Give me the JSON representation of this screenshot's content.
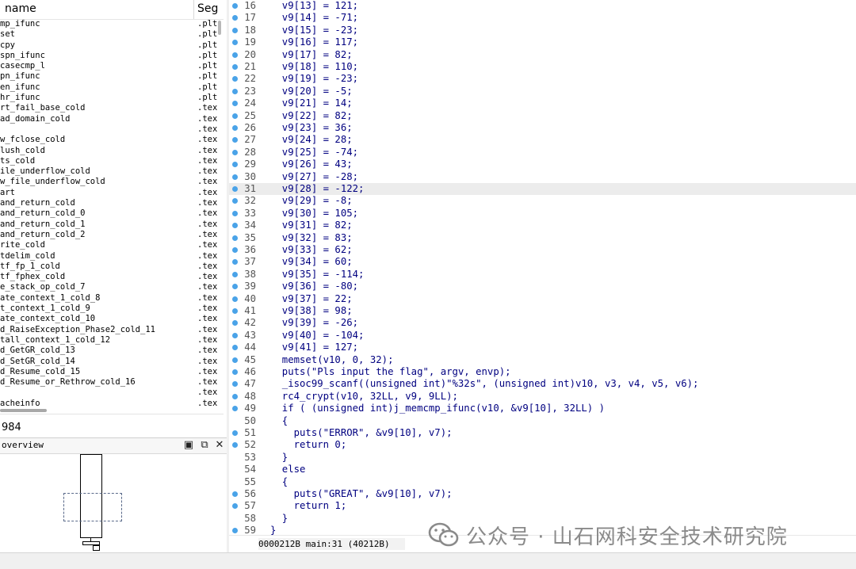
{
  "functions_panel": {
    "col_name": "name",
    "col_segment": "Seg",
    "rows": [
      {
        "name": "mp_ifunc",
        "seg": ".plt"
      },
      {
        "name": "set",
        "seg": ".plt"
      },
      {
        "name": "cpy",
        "seg": ".plt"
      },
      {
        "name": "spn_ifunc",
        "seg": ".plt"
      },
      {
        "name": "casecmp_l",
        "seg": ".plt"
      },
      {
        "name": "pn_ifunc",
        "seg": ".plt"
      },
      {
        "name": "en_ifunc",
        "seg": ".plt"
      },
      {
        "name": "hr_ifunc",
        "seg": ".plt"
      },
      {
        "name": "rt_fail_base_cold",
        "seg": ".tex"
      },
      {
        "name": "ad_domain_cold",
        "seg": ".tex"
      },
      {
        "name": "",
        "seg": ".tex"
      },
      {
        "name": "w_fclose_cold",
        "seg": ".tex"
      },
      {
        "name": "lush_cold",
        "seg": ".tex"
      },
      {
        "name": "ts_cold",
        "seg": ".tex"
      },
      {
        "name": "ile_underflow_cold",
        "seg": ".tex"
      },
      {
        "name": "w_file_underflow_cold",
        "seg": ".tex"
      },
      {
        "name": "art",
        "seg": ".tex"
      },
      {
        "name": "and_return_cold",
        "seg": ".tex"
      },
      {
        "name": "and_return_cold_0",
        "seg": ".tex"
      },
      {
        "name": "and_return_cold_1",
        "seg": ".tex"
      },
      {
        "name": "and_return_cold_2",
        "seg": ".tex"
      },
      {
        "name": "rite_cold",
        "seg": ".tex"
      },
      {
        "name": "tdelim_cold",
        "seg": ".tex"
      },
      {
        "name": "tf_fp_1_cold",
        "seg": ".tex"
      },
      {
        "name": "tf_fphex_cold",
        "seg": ".tex"
      },
      {
        "name": "e_stack_op_cold_7",
        "seg": ".tex"
      },
      {
        "name": "ate_context_1_cold_8",
        "seg": ".tex"
      },
      {
        "name": "t_context_1_cold_9",
        "seg": ".tex"
      },
      {
        "name": "ate_context_cold_10",
        "seg": ".tex"
      },
      {
        "name": "d_RaiseException_Phase2_cold_11",
        "seg": ".tex"
      },
      {
        "name": "tall_context_1_cold_12",
        "seg": ".tex"
      },
      {
        "name": "d_GetGR_cold_13",
        "seg": ".tex"
      },
      {
        "name": "d_SetGR_cold_14",
        "seg": ".tex"
      },
      {
        "name": "d_Resume_cold_15",
        "seg": ".tex"
      },
      {
        "name": "d_Resume_or_Rethrow_cold_16",
        "seg": ".tex"
      },
      {
        "name": "",
        "seg": ".tex"
      },
      {
        "name": "acheinfo",
        "seg": ".tex"
      }
    ],
    "line_count": "984"
  },
  "overview": {
    "title": "overview",
    "btn_float": "▣",
    "btn_restore": "⧉",
    "btn_close": "✕"
  },
  "code": {
    "lines": [
      {
        "n": "16",
        "dot": true,
        "t": "  v9[13] = 121;"
      },
      {
        "n": "17",
        "dot": true,
        "t": "  v9[14] = -71;"
      },
      {
        "n": "18",
        "dot": true,
        "t": "  v9[15] = -23;"
      },
      {
        "n": "19",
        "dot": true,
        "t": "  v9[16] = 117;"
      },
      {
        "n": "20",
        "dot": true,
        "t": "  v9[17] = 82;"
      },
      {
        "n": "21",
        "dot": true,
        "t": "  v9[18] = 110;"
      },
      {
        "n": "22",
        "dot": true,
        "t": "  v9[19] = -23;"
      },
      {
        "n": "23",
        "dot": true,
        "t": "  v9[20] = -5;"
      },
      {
        "n": "24",
        "dot": true,
        "t": "  v9[21] = 14;"
      },
      {
        "n": "25",
        "dot": true,
        "t": "  v9[22] = 82;"
      },
      {
        "n": "26",
        "dot": true,
        "t": "  v9[23] = 36;"
      },
      {
        "n": "27",
        "dot": true,
        "t": "  v9[24] = 28;"
      },
      {
        "n": "28",
        "dot": true,
        "t": "  v9[25] = -74;"
      },
      {
        "n": "29",
        "dot": true,
        "t": "  v9[26] = 43;"
      },
      {
        "n": "30",
        "dot": true,
        "t": "  v9[27] = -28;"
      },
      {
        "n": "31",
        "dot": true,
        "t": "  v9[28] = -122;",
        "hl": true
      },
      {
        "n": "32",
        "dot": true,
        "t": "  v9[29] = -8;"
      },
      {
        "n": "33",
        "dot": true,
        "t": "  v9[30] = 105;"
      },
      {
        "n": "34",
        "dot": true,
        "t": "  v9[31] = 82;"
      },
      {
        "n": "35",
        "dot": true,
        "t": "  v9[32] = 83;"
      },
      {
        "n": "36",
        "dot": true,
        "t": "  v9[33] = 62;"
      },
      {
        "n": "37",
        "dot": true,
        "t": "  v9[34] = 60;"
      },
      {
        "n": "38",
        "dot": true,
        "t": "  v9[35] = -114;"
      },
      {
        "n": "39",
        "dot": true,
        "t": "  v9[36] = -80;"
      },
      {
        "n": "40",
        "dot": true,
        "t": "  v9[37] = 22;"
      },
      {
        "n": "41",
        "dot": true,
        "t": "  v9[38] = 98;"
      },
      {
        "n": "42",
        "dot": true,
        "t": "  v9[39] = -26;"
      },
      {
        "n": "43",
        "dot": true,
        "t": "  v9[40] = -104;"
      },
      {
        "n": "44",
        "dot": true,
        "t": "  v9[41] = 127;"
      },
      {
        "n": "45",
        "dot": true,
        "t": "  memset(v10, 0, 32);"
      },
      {
        "n": "46",
        "dot": true,
        "t": "  puts(\"Pls input the flag\", argv, envp);"
      },
      {
        "n": "47",
        "dot": true,
        "t": "  _isoc99_scanf((unsigned int)\"%32s\", (unsigned int)v10, v3, v4, v5, v6);"
      },
      {
        "n": "48",
        "dot": true,
        "t": "  rc4_crypt(v10, 32LL, v9, 9LL);"
      },
      {
        "n": "49",
        "dot": true,
        "t": "  if ( (unsigned int)j_memcmp_ifunc(v10, &v9[10], 32LL) )"
      },
      {
        "n": "50",
        "dot": false,
        "t": "  {"
      },
      {
        "n": "51",
        "dot": true,
        "t": "    puts(\"ERROR\", &v9[10], v7);"
      },
      {
        "n": "52",
        "dot": true,
        "t": "    return 0;"
      },
      {
        "n": "53",
        "dot": false,
        "t": "  }"
      },
      {
        "n": "54",
        "dot": false,
        "t": "  else"
      },
      {
        "n": "55",
        "dot": false,
        "t": "  {"
      },
      {
        "n": "56",
        "dot": true,
        "t": "    puts(\"GREAT\", &v9[10], v7);"
      },
      {
        "n": "57",
        "dot": true,
        "t": "    return 1;"
      },
      {
        "n": "58",
        "dot": false,
        "t": "  }"
      },
      {
        "n": "59",
        "dot": true,
        "t": "}"
      }
    ],
    "status": "0000212B main:31 (40212B)"
  },
  "watermark": {
    "text": "公众号 · 山石网科安全技术研究院"
  },
  "colors": {
    "code_text": "#000080",
    "breakpoint_dot": "#4aa3e8",
    "highlight_line": "#ececec",
    "watermark": "#8a8a8a"
  }
}
